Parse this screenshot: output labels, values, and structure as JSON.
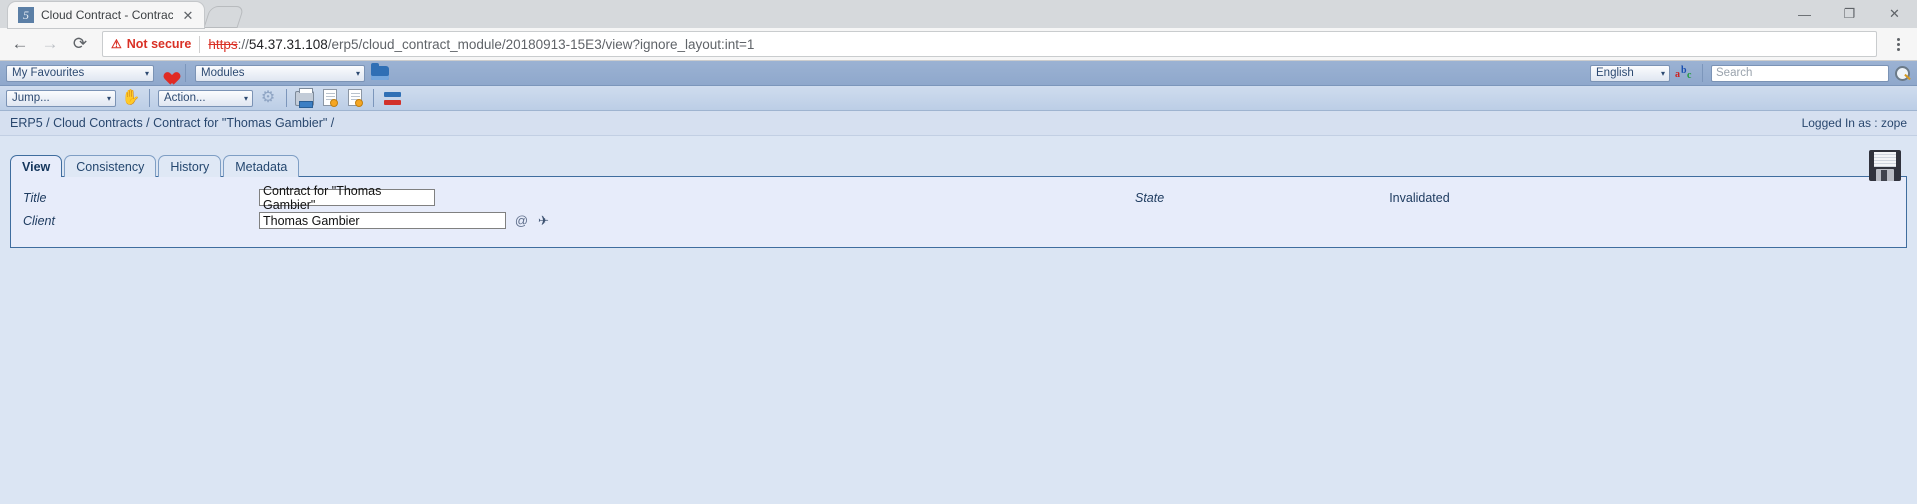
{
  "browser": {
    "tab": {
      "favicon_text": "5",
      "title": "Cloud Contract - Contrac",
      "close_label": "✕"
    },
    "window_controls": {
      "minimize": "—",
      "restore": "❐",
      "close": "✕"
    },
    "nav": {
      "back": "←",
      "forward": "→",
      "reload": "⟳"
    },
    "omnibox": {
      "security_icon": "⚠",
      "security_label": "Not secure",
      "url_scheme": "https",
      "url_sep": "://",
      "url_host": "54.37.31.108",
      "url_path": "/erp5/cloud_contract_module/20180913-15E3/view?ignore_layout:int=1"
    }
  },
  "erp_nav": {
    "favourites_select": "My Favourites",
    "favourites_icon": "heart-icon",
    "modules_select": "Modules",
    "modules_icon": "open-folder-icon",
    "language_select": "English",
    "translate_icon": "abc-translate-icon",
    "search_placeholder": "Search",
    "search_value": "",
    "search_icon": "magnifier-icon",
    "caret": "▾"
  },
  "erp_actions": {
    "jump_select": "Jump...",
    "jump_icon": "jump-plane-icon",
    "action_select": "Action...",
    "action_icon": "gear-seal-icon",
    "print_icon": "printer-icon",
    "new_doc_icon": "new-document-icon",
    "copy_doc_icon": "copy-document-icon",
    "exchange_icon": "exchange-icon",
    "caret": "▾"
  },
  "breadcrumb": {
    "text": "ERP5 / Cloud Contracts / Contract for \"Thomas Gambier\" /",
    "login_status": "Logged In as : zope"
  },
  "content": {
    "save_icon": "save-floppy-icon",
    "tabs": [
      {
        "label": "View",
        "active": true
      },
      {
        "label": "Consistency",
        "active": false
      },
      {
        "label": "History",
        "active": false
      },
      {
        "label": "Metadata",
        "active": false
      }
    ],
    "fields": {
      "title_label": "Title",
      "title_value": "Contract for \"Thomas Gambier\"",
      "client_label": "Client",
      "client_value": "Thomas Gambier",
      "client_relation_icon": "@",
      "client_jump_icon": "✈",
      "state_label": "State",
      "state_value": "Invalidated"
    }
  },
  "colors": {
    "nav_blue": "#94aed0",
    "action_blue": "#bccee6",
    "page_bg": "#dbe5f3",
    "panel_bg": "#e7ecfa",
    "panel_border": "#3f6d9e",
    "not_secure_red": "#d93025"
  }
}
